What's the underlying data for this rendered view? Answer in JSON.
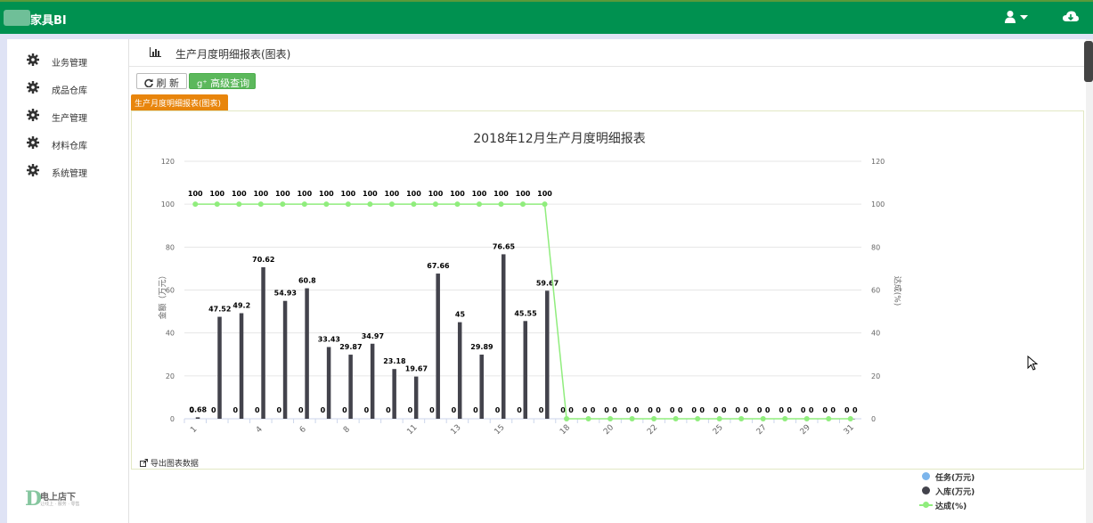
{
  "app": {
    "title": "家具BI"
  },
  "sidebar": {
    "items": [
      {
        "label": "业务管理"
      },
      {
        "label": "成品仓库"
      },
      {
        "label": "生产管理"
      },
      {
        "label": "材料仓库"
      },
      {
        "label": "系统管理"
      }
    ],
    "logo": {
      "letter": "D",
      "text": "电上店下",
      "sub": "让线上 · 服务 · 零售"
    }
  },
  "page": {
    "title": "生产月度明细报表(图表)",
    "refresh_label": "刷 新",
    "query_label": "高级查询",
    "tab_label": "生产月度明细报表(图表)",
    "export_label": "导出图表数据"
  },
  "colors": {
    "topbar": "#009150",
    "bar": "#43434c",
    "line": "#90ed7d",
    "task": "#7cb5ec"
  },
  "icons": {
    "user": "user-icon",
    "cloud": "cloud-icon",
    "gear": "gear-icon",
    "chart": "bar-chart-icon",
    "refresh": "refresh-icon",
    "plus": "google-plus-icon",
    "export": "export-icon"
  },
  "chart_data": {
    "type": "bar",
    "title": "2018年12月生产月度明细报表",
    "ylabel": "金额（万元）",
    "y2label": "达成(%)",
    "ylim": [
      0,
      120
    ],
    "y2lim": [
      0,
      120
    ],
    "yticks": [
      0,
      20,
      40,
      60,
      80,
      100,
      120
    ],
    "categories": [
      1,
      2,
      3,
      4,
      5,
      6,
      7,
      8,
      9,
      10,
      11,
      12,
      13,
      14,
      15,
      16,
      17,
      18,
      19,
      20,
      21,
      22,
      23,
      24,
      25,
      26,
      27,
      28,
      29,
      30,
      31
    ],
    "xtick_labels": [
      "1",
      "4",
      "6",
      "8",
      "11",
      "13",
      "15",
      "18",
      "20",
      "22",
      "25",
      "27",
      "29",
      "31"
    ],
    "series": [
      {
        "name": "任务(万元)",
        "type": "bar",
        "values": [
          0,
          0,
          0,
          0,
          0,
          0,
          0,
          0,
          0,
          0,
          0,
          0,
          0,
          0,
          0,
          0,
          0,
          0,
          0,
          0,
          0,
          0,
          0,
          0,
          0,
          0,
          0,
          0,
          0,
          0,
          0
        ]
      },
      {
        "name": "入库(万元)",
        "type": "bar",
        "values": [
          0.68,
          47.52,
          49.2,
          70.62,
          54.93,
          60.8,
          33.43,
          29.87,
          34.97,
          23.18,
          19.67,
          67.66,
          45,
          29.89,
          76.65,
          45.55,
          59.67,
          0,
          0,
          0,
          0,
          0,
          0,
          0,
          0,
          0,
          0,
          0,
          0,
          0,
          0
        ]
      },
      {
        "name": "达成(%)",
        "type": "line",
        "axis": "right",
        "values": [
          100,
          100,
          100,
          100,
          100,
          100,
          100,
          100,
          100,
          100,
          100,
          100,
          100,
          100,
          100,
          100,
          100,
          0,
          0,
          0,
          0,
          0,
          0,
          0,
          0,
          0,
          0,
          0,
          0,
          0,
          0
        ]
      }
    ],
    "legend_position": "bottom-right",
    "grid": true
  }
}
